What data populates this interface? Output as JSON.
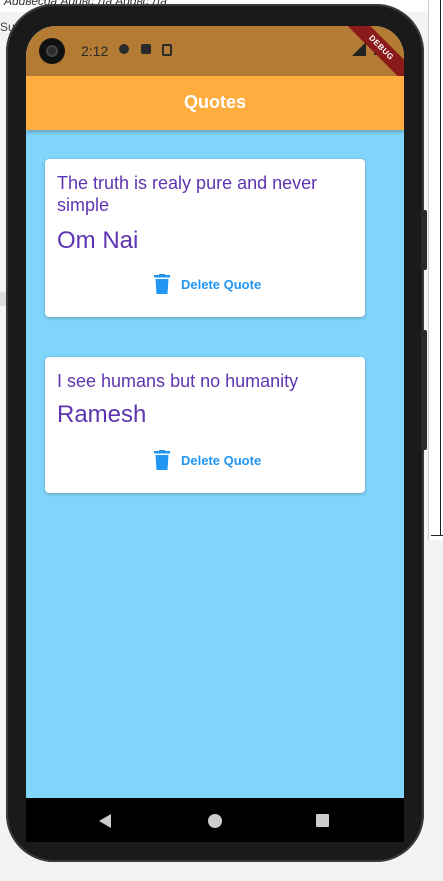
{
  "background": {
    "top_text": "Аddвесда  Addвс Дa  Addвс Дa",
    "side_text": "Su"
  },
  "statusbar": {
    "time": "2:12",
    "debug_banner": "DEBUG"
  },
  "appbar": {
    "title": "Quotes",
    "color": "#ffad3f"
  },
  "quotes": [
    {
      "text": "The truth is realy pure and never simple",
      "author": "Om Nai",
      "delete_label": "Delete Quote"
    },
    {
      "text": "I see humans but no humanity",
      "author": "Ramesh",
      "delete_label": "Delete Quote"
    }
  ],
  "colors": {
    "screen_background": "#81d4fa",
    "text_purple": "#5e35b1",
    "button_blue": "#2196f3"
  },
  "icons": {
    "delete": "trash-icon",
    "nav_back": "back-triangle-icon",
    "nav_home": "home-circle-icon",
    "nav_recent": "recent-square-icon"
  }
}
